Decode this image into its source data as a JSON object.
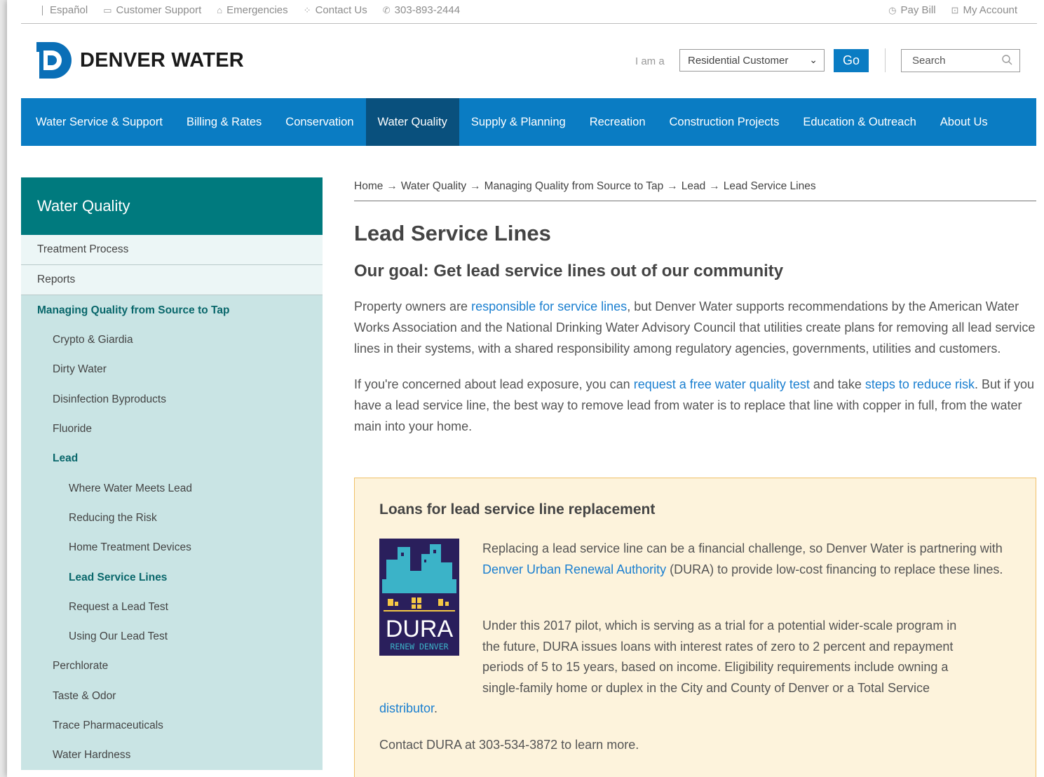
{
  "utility": {
    "left": [
      {
        "label": "Español",
        "icon": "divider"
      },
      {
        "label": "Customer Support",
        "icon": "chat-icon"
      },
      {
        "label": "Emergencies",
        "icon": "alert-icon"
      },
      {
        "label": "Contact Us",
        "icon": "grid-icon"
      },
      {
        "label": "303-893-2444",
        "icon": "phone-icon"
      }
    ],
    "right": [
      {
        "label": "Pay Bill",
        "icon": "clock-icon"
      },
      {
        "label": "My Account",
        "icon": "account-icon"
      }
    ]
  },
  "header": {
    "logo_text": "DENVER WATER",
    "iam_label": "I am a",
    "customer_select": "Residential Customer",
    "go_label": "Go",
    "search_placeholder": "Search"
  },
  "nav": [
    "Water Service & Support",
    "Billing & Rates",
    "Conservation",
    "Water Quality",
    "Supply & Planning",
    "Recreation",
    "Construction Projects",
    "Education & Outreach",
    "About Us"
  ],
  "sidebar": {
    "title": "Water Quality",
    "top": [
      "Treatment Process",
      "Reports"
    ],
    "active": "Managing Quality from Source to Tap",
    "sub": [
      {
        "label": "Crypto & Giardia",
        "level": 1
      },
      {
        "label": "Dirty Water",
        "level": 1
      },
      {
        "label": "Disinfection Byproducts",
        "level": 1
      },
      {
        "label": "Fluoride",
        "level": 1
      },
      {
        "label": "Lead",
        "level": 1,
        "current": true
      },
      {
        "label": "Where Water Meets Lead",
        "level": 2
      },
      {
        "label": "Reducing the Risk",
        "level": 2
      },
      {
        "label": "Home Treatment Devices",
        "level": 2
      },
      {
        "label": "Lead Service Lines",
        "level": 2,
        "current": true
      },
      {
        "label": "Request a Lead Test",
        "level": 2
      },
      {
        "label": "Using Our Lead Test",
        "level": 2
      },
      {
        "label": "Perchlorate",
        "level": 1
      },
      {
        "label": "Taste & Odor",
        "level": 1
      },
      {
        "label": "Trace Pharmaceuticals",
        "level": 1
      },
      {
        "label": "Water Hardness",
        "level": 1
      }
    ]
  },
  "breadcrumb": [
    "Home",
    "Water Quality",
    "Managing Quality from Source to Tap",
    "Lead",
    "Lead Service Lines"
  ],
  "content": {
    "title": "Lead Service Lines",
    "subtitle": "Our goal: Get lead service lines out of our community",
    "p1": {
      "before": "Property owners are ",
      "link": "responsible for service lines",
      "after": ", but Denver Water supports recommendations by the American Water Works Association and the National Drinking Water Advisory Council that utilities create plans for removing all lead service lines in their systems, with a shared responsibility among regulatory agencies, governments, utilities and customers."
    },
    "p2": {
      "before": "If you're concerned about lead exposure, you can ",
      "link1": "request a free water quality test",
      "middle": " and take ",
      "link2": "steps to reduce risk",
      "after": ". But if you have a lead service line, the best way to remove lead from water is to replace that line with copper in full, from the water main into your home."
    }
  },
  "callout": {
    "title": "Loans for lead service line replacement",
    "logo_main": "DURA",
    "logo_sub": "RENEW DENVER",
    "c1_before": "Replacing a lead service line can be a financial challenge, so Denver Water is partnering with ",
    "c1_link": "Denver Urban Renewal Authority",
    "c1_after": " (DURA) to provide low-cost financing to replace these lines.",
    "c2_line1": "Under this 2017 pilot, which is serving as a trial for a potential wider-scale program in",
    "c2_line2": "the future, DURA issues loans with interest rates of zero to 2 percent and repayment",
    "c2_line3": "periods of 5 to 15 years, based on income. Eligibility requirements include owning a",
    "c2_line4": "single-family home or duplex in the City and County of Denver or a Total Service",
    "c2_link": "distributor",
    "c2_end": ".",
    "c3": "Contact DURA at 303-534-3872 to learn more."
  },
  "colors": {
    "nav_blue": "#0a7cc3",
    "nav_active": "#09507d",
    "teal": "#007a7e",
    "sidebar_bg": "#c9e4e4",
    "link": "#1a7fd0",
    "callout_bg": "#fdf3dc"
  }
}
